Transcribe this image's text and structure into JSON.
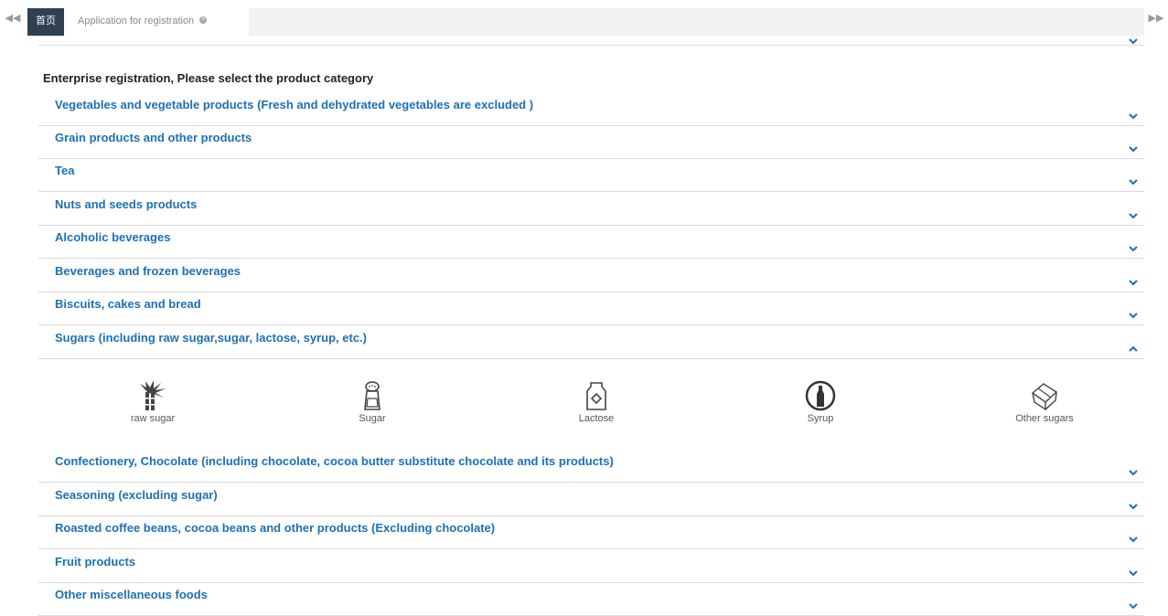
{
  "tabs": {
    "home_label": "首页",
    "active_label": "Application for registration"
  },
  "heading": "Enterprise registration, Please select the product category",
  "categories": [
    {
      "label": "Vegetables and vegetable products  (Fresh and dehydrated vegetables are excluded )",
      "expanded": false
    },
    {
      "label": "Grain products and other products",
      "expanded": false
    },
    {
      "label": "Tea",
      "expanded": false
    },
    {
      "label": "Nuts and seeds products",
      "expanded": false
    },
    {
      "label": "Alcoholic beverages",
      "expanded": false
    },
    {
      "label": "Beverages and frozen beverages",
      "expanded": false
    },
    {
      "label": "Biscuits, cakes and bread",
      "expanded": false
    },
    {
      "label": "Sugars (including raw sugar,sugar, lactose, syrup, etc.)",
      "expanded": true
    },
    {
      "label": "Confectionery, Chocolate (including chocolate, cocoa butter substitute chocolate and its products)",
      "expanded": false
    },
    {
      "label": "Seasoning (excluding sugar)",
      "expanded": false
    },
    {
      "label": "Roasted coffee beans, cocoa beans and other products (Excluding chocolate)",
      "expanded": false
    },
    {
      "label": "Fruit products",
      "expanded": false
    },
    {
      "label": "Other miscellaneous foods",
      "expanded": false
    }
  ],
  "sugar_items": [
    {
      "label": "raw sugar",
      "icon": "sugarcane-icon"
    },
    {
      "label": "Sugar",
      "icon": "sugar-shaker-icon"
    },
    {
      "label": "Lactose",
      "icon": "milk-carton-icon"
    },
    {
      "label": "Syrup",
      "icon": "syrup-bottle-icon"
    },
    {
      "label": "Other sugars",
      "icon": "sugar-cube-icon"
    }
  ],
  "colors": {
    "category_text": "#1d6fb8",
    "home_tab_bg": "#2f4050",
    "tabstrip_bg": "#f1f2f4",
    "divider": "#dcdcdc"
  }
}
